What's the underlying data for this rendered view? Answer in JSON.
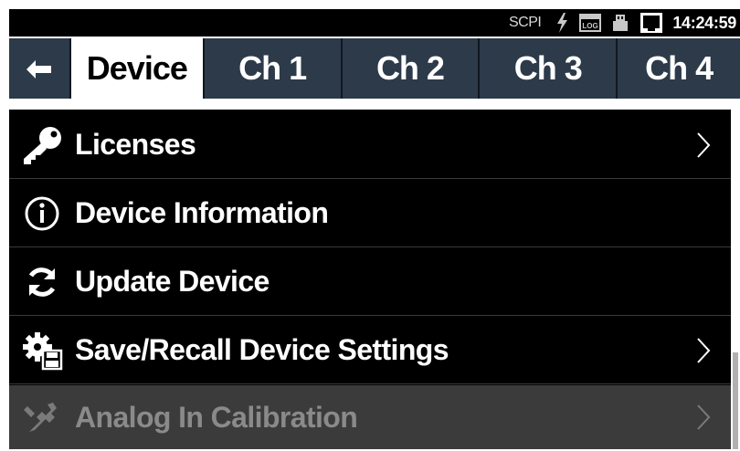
{
  "status_bar": {
    "scpi_label": "SCPI",
    "icons": [
      "lightning-icon",
      "log-icon",
      "usb-icon",
      "network-icon"
    ],
    "log_icon_text": "LOG",
    "time": "14:24:59"
  },
  "tabs": {
    "back_icon": "back-arrow-icon",
    "items": [
      {
        "label": "Device",
        "active": true
      },
      {
        "label": "Ch 1",
        "active": false
      },
      {
        "label": "Ch 2",
        "active": false
      },
      {
        "label": "Ch 3",
        "active": false
      },
      {
        "label": "Ch 4",
        "active": false
      }
    ]
  },
  "menu": {
    "items": [
      {
        "label": "Licenses",
        "icon": "key-icon",
        "has_submenu": true,
        "enabled": true
      },
      {
        "label": "Device Information",
        "icon": "info-icon",
        "has_submenu": false,
        "enabled": true
      },
      {
        "label": "Update Device",
        "icon": "refresh-icon",
        "has_submenu": false,
        "enabled": true
      },
      {
        "label": "Save/Recall Device Settings",
        "icon": "gear-save-icon",
        "has_submenu": true,
        "enabled": true
      },
      {
        "label": "Analog In Calibration",
        "icon": "calibration-icon",
        "has_submenu": true,
        "enabled": false
      }
    ]
  },
  "colors": {
    "tab_background": "#2c3a4a",
    "active_tab": "#ffffff",
    "menu_background": "#000000",
    "disabled_row": "#3b3b3b"
  }
}
